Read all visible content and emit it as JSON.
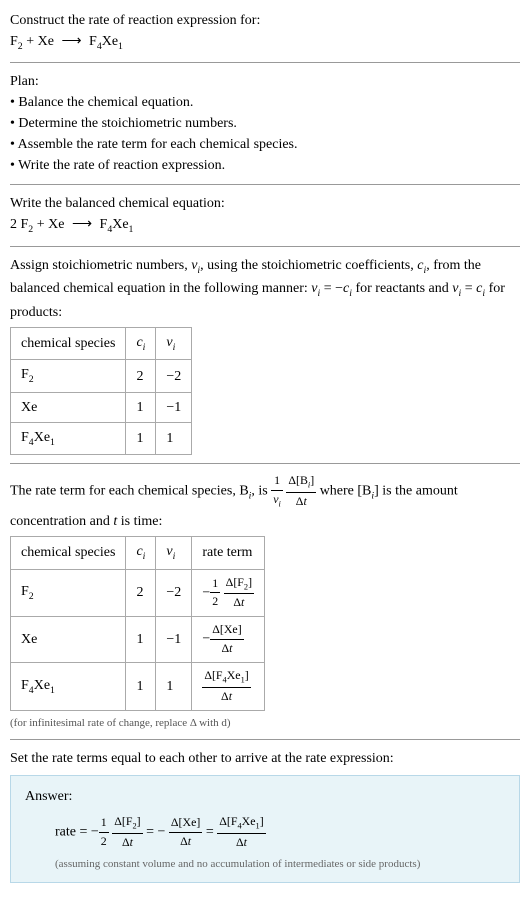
{
  "intro": {
    "title": "Construct the rate of reaction expression for:",
    "equation_lhs1": "F",
    "equation_lhs1_sub": "2",
    "equation_plus": " + Xe ",
    "equation_arrow": "⟶",
    "equation_rhs": " F",
    "equation_rhs_sub1": "4",
    "equation_rhs2": "Xe",
    "equation_rhs_sub2": "1"
  },
  "plan": {
    "title": "Plan:",
    "b1": "• Balance the chemical equation.",
    "b2": "• Determine the stoichiometric numbers.",
    "b3": "• Assemble the rate term for each chemical species.",
    "b4": "• Write the rate of reaction expression."
  },
  "balanced": {
    "title": "Write the balanced chemical equation:",
    "coef": "2 F",
    "sub1": "2",
    "plus": " + Xe ",
    "arrow": "⟶",
    "rhs": " F",
    "rhs_sub1": "4",
    "rhs2": "Xe",
    "rhs_sub2": "1"
  },
  "stoich": {
    "text1": "Assign stoichiometric numbers, ",
    "nu": "ν",
    "sub_i": "i",
    "text2": ", using the stoichiometric coefficients, ",
    "c": "c",
    "text3": ", from the balanced chemical equation in the following manner: ",
    "eq1": " = −",
    "text4": " for reactants and ",
    "eq2": " = ",
    "text5": " for products:",
    "table": {
      "h1": "chemical species",
      "h2": "c",
      "h3": "ν",
      "r1c1a": "F",
      "r1c1b": "2",
      "r1c2": "2",
      "r1c3": "−2",
      "r2c1": "Xe",
      "r2c2": "1",
      "r2c3": "−1",
      "r3c1a": "F",
      "r3c1b": "4",
      "r3c1c": "Xe",
      "r3c1d": "1",
      "r3c2": "1",
      "r3c3": "1"
    }
  },
  "rateTerm": {
    "text1": "The rate term for each chemical species, B",
    "text2": ", is ",
    "frac1_num": "1",
    "frac1_den_nu": "ν",
    "frac2_num": "Δ[B",
    "frac2_num2": "]",
    "frac2_den": "Δt",
    "text3": " where [B",
    "text4": "] is the amount concentration and ",
    "t": "t",
    "text5": " is time:",
    "table": {
      "h1": "chemical species",
      "h2": "c",
      "h3": "ν",
      "h4": "rate term",
      "r1c1a": "F",
      "r1c1b": "2",
      "r1c2": "2",
      "r1c3": "−2",
      "r1c4_neg": "−",
      "r1c4_half_num": "1",
      "r1c4_half_den": "2",
      "r1c4_frac_num": "Δ[F",
      "r1c4_frac_num_sub": "2",
      "r1c4_frac_num2": "]",
      "r1c4_frac_den": "Δt",
      "r2c1": "Xe",
      "r2c2": "1",
      "r2c3": "−1",
      "r2c4_neg": "−",
      "r2c4_frac_num": "Δ[Xe]",
      "r2c4_frac_den": "Δt",
      "r3c1a": "F",
      "r3c1b": "4",
      "r3c1c": "Xe",
      "r3c1d": "1",
      "r3c2": "1",
      "r3c3": "1",
      "r3c4_frac_num1": "Δ[F",
      "r3c4_frac_num_sub1": "4",
      "r3c4_frac_num2": "Xe",
      "r3c4_frac_num_sub2": "1",
      "r3c4_frac_num3": "]",
      "r3c4_frac_den": "Δt"
    },
    "note": "(for infinitesimal rate of change, replace Δ with d)"
  },
  "final": {
    "title": "Set the rate terms equal to each other to arrive at the rate expression:",
    "answer_label": "Answer:",
    "rate": "rate = −",
    "half_num": "1",
    "half_den": "2",
    "f1_num": "Δ[F",
    "f1_sub": "2",
    "f1_num2": "]",
    "f1_den": "Δt",
    "eq": " = −",
    "f2_num": "Δ[Xe]",
    "f2_den": "Δt",
    "eq2": " = ",
    "f3_num1": "Δ[F",
    "f3_sub1": "4",
    "f3_num2": "Xe",
    "f3_sub2": "1",
    "f3_num3": "]",
    "f3_den": "Δt",
    "note": "(assuming constant volume and no accumulation of intermediates or side products)"
  }
}
